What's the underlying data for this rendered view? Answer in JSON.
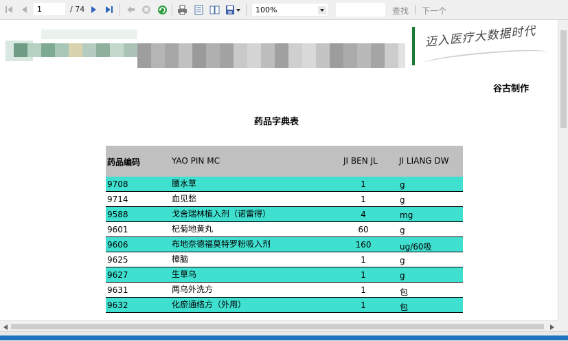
{
  "toolbar": {
    "current_page": "1",
    "page_count": "/ 74",
    "zoom": "100%",
    "find_label": "查找",
    "next_label": "下一个"
  },
  "banner": {
    "slogan": "迈入医疗大数据时代"
  },
  "report": {
    "producer": "谷古制作",
    "title": "药品字典表",
    "headers": [
      "药品编码",
      "YAO PIN MC",
      "JI BEN JL",
      "JI LIANG DW"
    ],
    "rows": [
      {
        "code": "9708",
        "name": "腰水草",
        "qty": "1",
        "unit": "g"
      },
      {
        "code": "9714",
        "name": "血见愁",
        "qty": "1",
        "unit": "g"
      },
      {
        "code": "9588",
        "name": "戈舍瑞林植入剂（诺雷得）",
        "qty": "4",
        "unit": "mg"
      },
      {
        "code": "9601",
        "name": "杞菊地黄丸",
        "qty": "60",
        "unit": "g"
      },
      {
        "code": "9606",
        "name": "布地奈德福莫特罗粉吸入剂",
        "qty": "160",
        "unit": "ug/60吸"
      },
      {
        "code": "9625",
        "name": "樟脑",
        "qty": "1",
        "unit": "g"
      },
      {
        "code": "9627",
        "name": "生草乌",
        "qty": "1",
        "unit": "g"
      },
      {
        "code": "9631",
        "name": "两乌外洗方",
        "qty": "1",
        "unit": "包"
      },
      {
        "code": "9632",
        "name": "化瘀通络方（外用）",
        "qty": "1",
        "unit": "包"
      }
    ]
  },
  "colors": {
    "row_highlight": "#40e0d0",
    "header_bg": "#c0c0c0",
    "brand_green": "#1a7a34"
  }
}
